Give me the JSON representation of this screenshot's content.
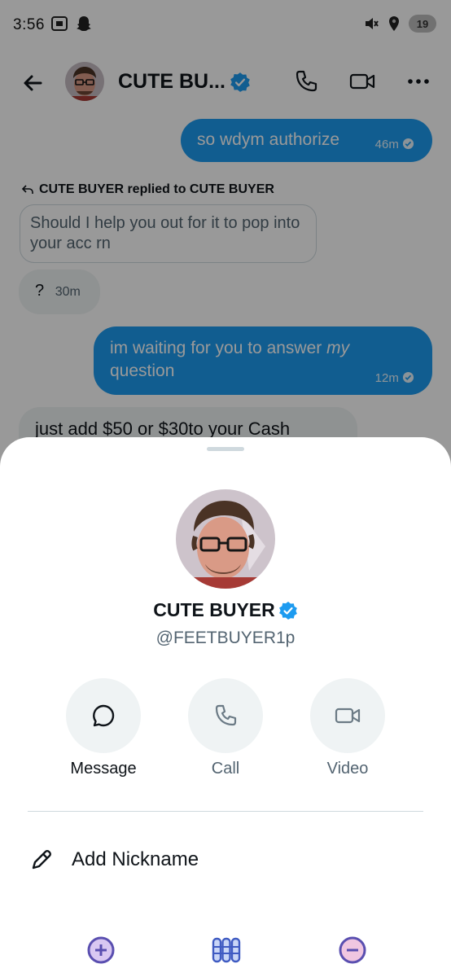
{
  "status_bar": {
    "time": "3:56",
    "battery": "19",
    "left_icons": [
      "screenshot-icon",
      "snapchat-icon"
    ],
    "right_icons": [
      "mute-vibrate-icon",
      "location-icon",
      "battery-icon"
    ]
  },
  "chat": {
    "contact_name": "CUTE BU...",
    "header_icons": [
      "back-arrow-icon",
      "phone-icon",
      "video-camera-icon",
      "more-icon"
    ],
    "messages": [
      {
        "text": "so wdym authorize",
        "time": "46m"
      },
      {
        "reply_label": "CUTE BUYER replied to CUTE BUYER",
        "quoted": "Should I help you out for it to pop into your acc rn"
      },
      {
        "text": "?",
        "time": "30m"
      },
      {
        "text_before": "im waiting for you to answer ",
        "text_italic": "my",
        "text_after": "question",
        "time": "12m"
      },
      {
        "text": "just add  $50 or $30to your Cash"
      }
    ]
  },
  "sheet": {
    "name": "CUTE BUYER",
    "handle": "@FEETBUYER1p",
    "actions": [
      {
        "label": "Message",
        "icon": "chat-bubble-icon"
      },
      {
        "label": "Call",
        "icon": "phone-icon"
      },
      {
        "label": "Video",
        "icon": "video-camera-icon"
      }
    ],
    "nickname_label": "Add Nickname"
  },
  "colors": {
    "accent": "#1d9bf0",
    "sheet_bg": "#ffffff",
    "muted_text": "#536471"
  }
}
